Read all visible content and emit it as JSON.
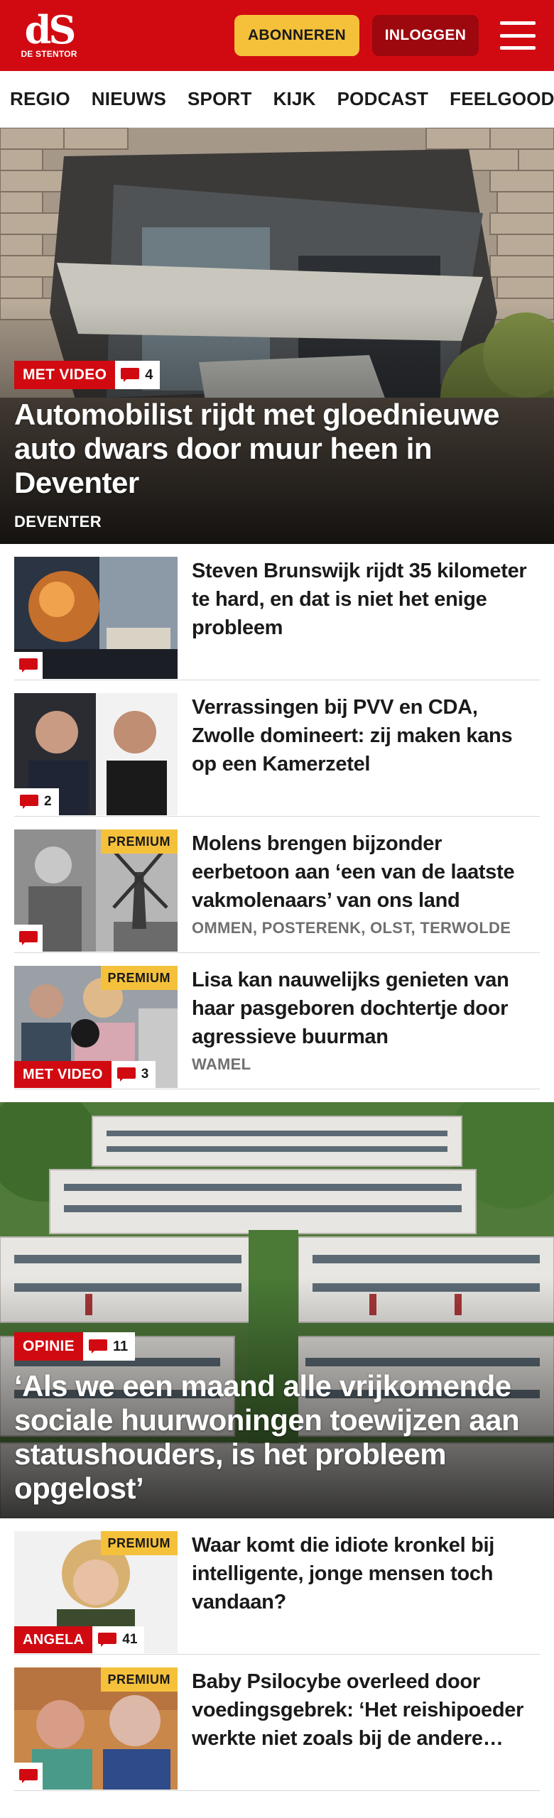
{
  "brand": {
    "logo_mark": "dS",
    "logo_sub": "DE STENTOR"
  },
  "header": {
    "subscribe_label": "ABONNEREN",
    "login_label": "INLOGGEN"
  },
  "nav": {
    "items": [
      "REGIO",
      "NIEUWS",
      "SPORT",
      "KIJK",
      "PODCAST",
      "FEELGOOD"
    ]
  },
  "hero": {
    "label": "MET VIDEO",
    "comments": "4",
    "title": "Automobilist rijdt met gloednieuwe auto dwars door muur heen in Deventer",
    "location": "DEVENTER"
  },
  "articles": [
    {
      "title": "Steven Brunswijk rijdt 35 kilometer te hard, en dat is niet het enige probleem",
      "location": "",
      "premium": "",
      "label": "",
      "comments": ""
    },
    {
      "title": "Verrassingen bij PVV en CDA, Zwolle domineert: zij maken kans op een Kamerzetel",
      "location": "",
      "premium": "",
      "label": "",
      "comments": "2"
    },
    {
      "title": "Molens brengen bijzonder eerbetoon aan ‘een van de laatste vakmolenaars’ van ons land",
      "location": "OMMEN, POSTERENK, OLST, TERWOLDE",
      "premium": "PREMIUM",
      "label": "",
      "comments": ""
    },
    {
      "title": "Lisa kan nauwelijks genieten van haar pasgeboren dochtertje door agressieve buurman",
      "location": "WAMEL",
      "premium": "PREMIUM",
      "label": "MET VIDEO",
      "comments": "3"
    }
  ],
  "hero2": {
    "label": "OPINIE",
    "comments": "11",
    "title": "‘Als we een maand alle vrijkomende sociale huurwoningen toewijzen aan statushouders, is het probleem opgelost’"
  },
  "articles2": [
    {
      "title": "Waar komt die idiote kronkel bij intelligente, jonge mensen toch vandaan?",
      "premium": "PREMIUM",
      "label": "ANGELA",
      "comments": "41"
    },
    {
      "title": "Baby Psilocybe overleed door voedingsgebrek: ‘Het reishipoeder werkte niet zoals bij de andere kinderen’",
      "premium": "PREMIUM",
      "label": "",
      "comments": ""
    }
  ],
  "colors": {
    "brand_red": "#d10a11",
    "dark_red": "#9d070e",
    "premium_yellow": "#f5c13b"
  }
}
